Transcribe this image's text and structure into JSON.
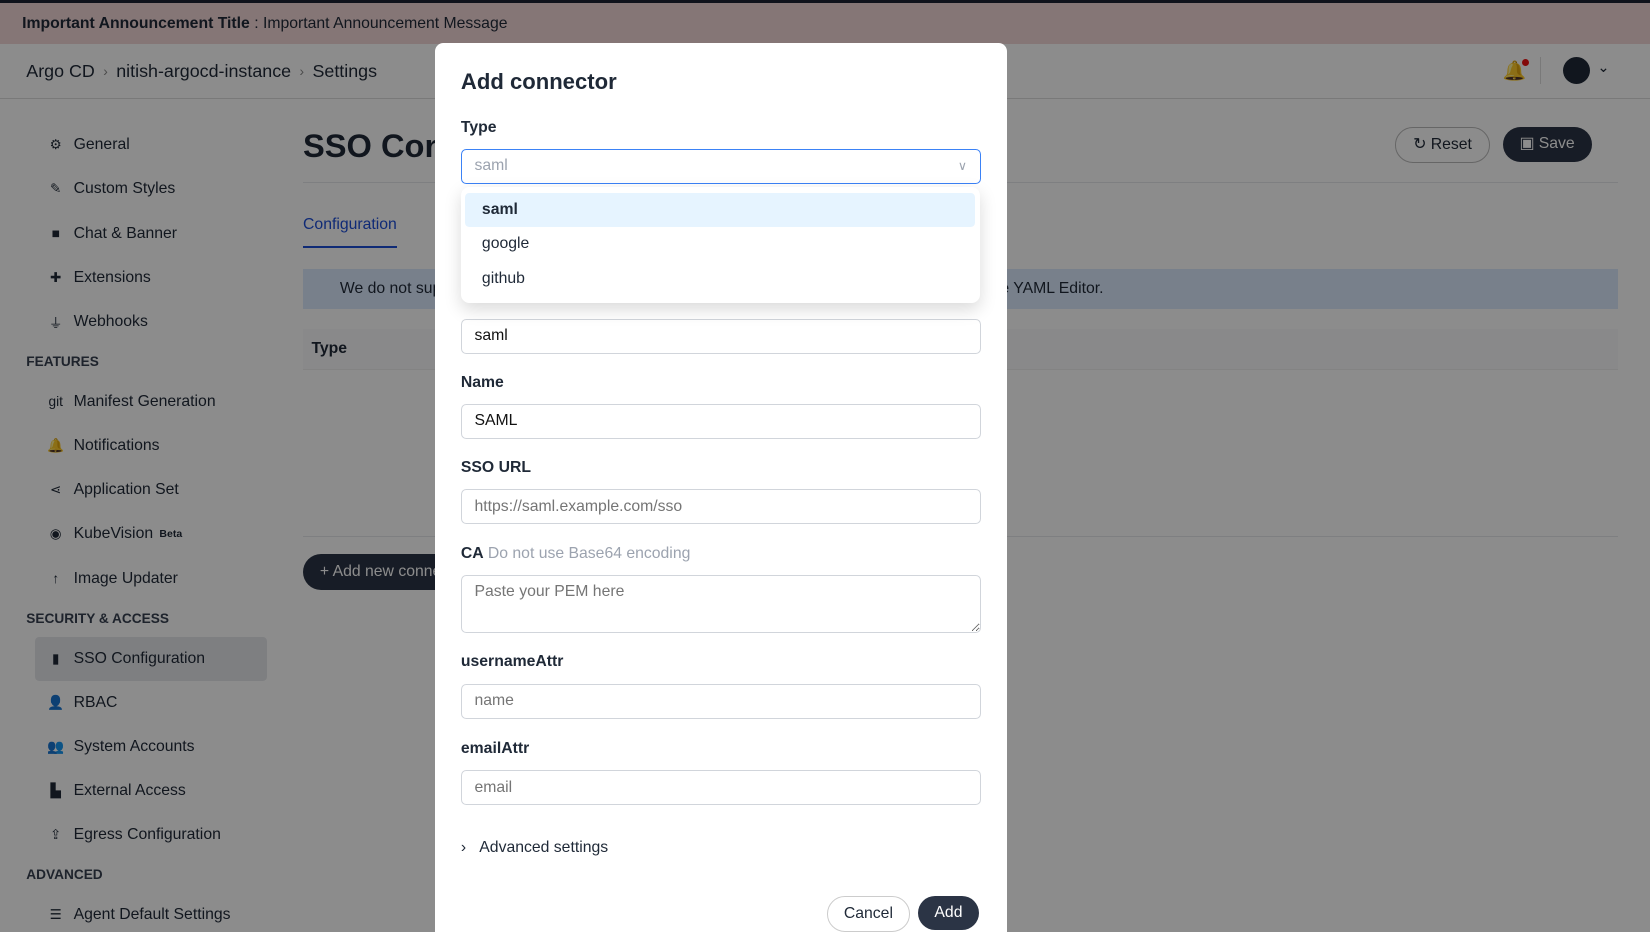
{
  "announcement": {
    "title": "Important Announcement Title",
    "separator": " : ",
    "message": "Important Announcement Message"
  },
  "breadcrumb": [
    "Argo CD",
    "nitish-argocd-instance",
    "Settings"
  ],
  "sidebar": {
    "items_top": [
      {
        "label": "General",
        "icon": "gear-icon",
        "glyph": "⚙"
      },
      {
        "label": "Custom Styles",
        "icon": "brush-icon",
        "glyph": "✎"
      },
      {
        "label": "Chat & Banner",
        "icon": "chat-icon",
        "glyph": "■"
      },
      {
        "label": "Extensions",
        "icon": "puzzle-icon",
        "glyph": "✚"
      },
      {
        "label": "Webhooks",
        "icon": "plug-icon",
        "glyph": "⏚"
      }
    ],
    "features_label": "FEATURES",
    "features": [
      {
        "label": "Manifest Generation",
        "icon": "git-icon",
        "glyph": "git"
      },
      {
        "label": "Notifications",
        "icon": "bell-icon",
        "glyph": "🔔"
      },
      {
        "label": "Application Set",
        "icon": "share-icon",
        "glyph": "⋖"
      },
      {
        "label": "KubeVision",
        "badge": "Beta",
        "icon": "eye-icon",
        "glyph": "◉"
      },
      {
        "label": "Image Updater",
        "icon": "arrow-up-icon",
        "glyph": "↑"
      }
    ],
    "security_label": "SECURITY & ACCESS",
    "security": [
      {
        "label": "SSO Configuration",
        "icon": "id-card-icon",
        "glyph": "▮",
        "active": true
      },
      {
        "label": "RBAC",
        "icon": "user-lock-icon",
        "glyph": "👤"
      },
      {
        "label": "System Accounts",
        "icon": "users-icon",
        "glyph": "👥"
      },
      {
        "label": "External Access",
        "icon": "door-icon",
        "glyph": "▙"
      },
      {
        "label": "Egress Configuration",
        "icon": "upload-icon",
        "glyph": "⇪"
      }
    ],
    "advanced_label": "ADVANCED",
    "advanced": [
      {
        "label": "Agent Default Settings",
        "icon": "server-icon",
        "glyph": "☰"
      }
    ]
  },
  "main": {
    "title": "SSO Configuration",
    "reset": "Reset",
    "save": "Save",
    "tab": "Configuration",
    "info": "We do not support all configuration options in this form. For advanced configuration you can use YAML Editor.",
    "table_header": "Type",
    "add_button": "Add new connector"
  },
  "modal": {
    "title": "Add connector",
    "type_label": "Type",
    "type_value": "saml",
    "type_options": [
      "saml",
      "google",
      "github"
    ],
    "id_value": "saml",
    "name_label": "Name",
    "name_value": "SAML",
    "sso_url_label": "SSO URL",
    "sso_url_placeholder": "https://saml.example.com/sso",
    "ca_label": "CA",
    "ca_hint": "Do not use Base64 encoding",
    "ca_placeholder": "Paste your PEM here",
    "username_label": "usernameAttr",
    "username_placeholder": "name",
    "email_label": "emailAttr",
    "email_placeholder": "email",
    "advanced": "Advanced settings",
    "cancel": "Cancel",
    "add": "Add"
  }
}
